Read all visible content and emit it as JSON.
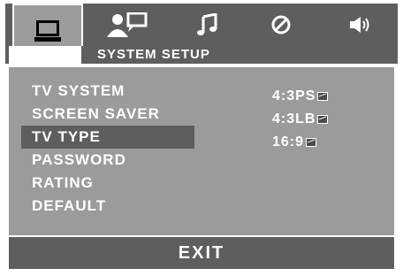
{
  "tabs": [
    {
      "icon": "monitor-icon",
      "active": true
    },
    {
      "icon": "person-speech-icon",
      "active": false
    },
    {
      "icon": "music-note-icon",
      "active": false
    },
    {
      "icon": "circle-slash-icon",
      "active": false
    },
    {
      "icon": "speaker-icon",
      "active": false
    }
  ],
  "header": {
    "title": "SYSTEM SETUP"
  },
  "menu": {
    "items": [
      {
        "label": "TV SYSTEM"
      },
      {
        "label": "SCREEN SAVER"
      },
      {
        "label": "TV TYPE"
      },
      {
        "label": "PASSWORD"
      },
      {
        "label": "RATING"
      },
      {
        "label": "DEFAULT"
      }
    ],
    "selected_index": 2
  },
  "options": [
    {
      "label": "4:3PS",
      "icon": "aspect-image-icon"
    },
    {
      "label": "4:3LB",
      "icon": "aspect-image-icon"
    },
    {
      "label": "16:9",
      "icon": "aspect-image-icon"
    }
  ],
  "footer": {
    "exit_label": "EXIT"
  },
  "colors": {
    "dark": "#5e5e5e",
    "panel": "#9b9b9b",
    "text": "#ffffff"
  }
}
